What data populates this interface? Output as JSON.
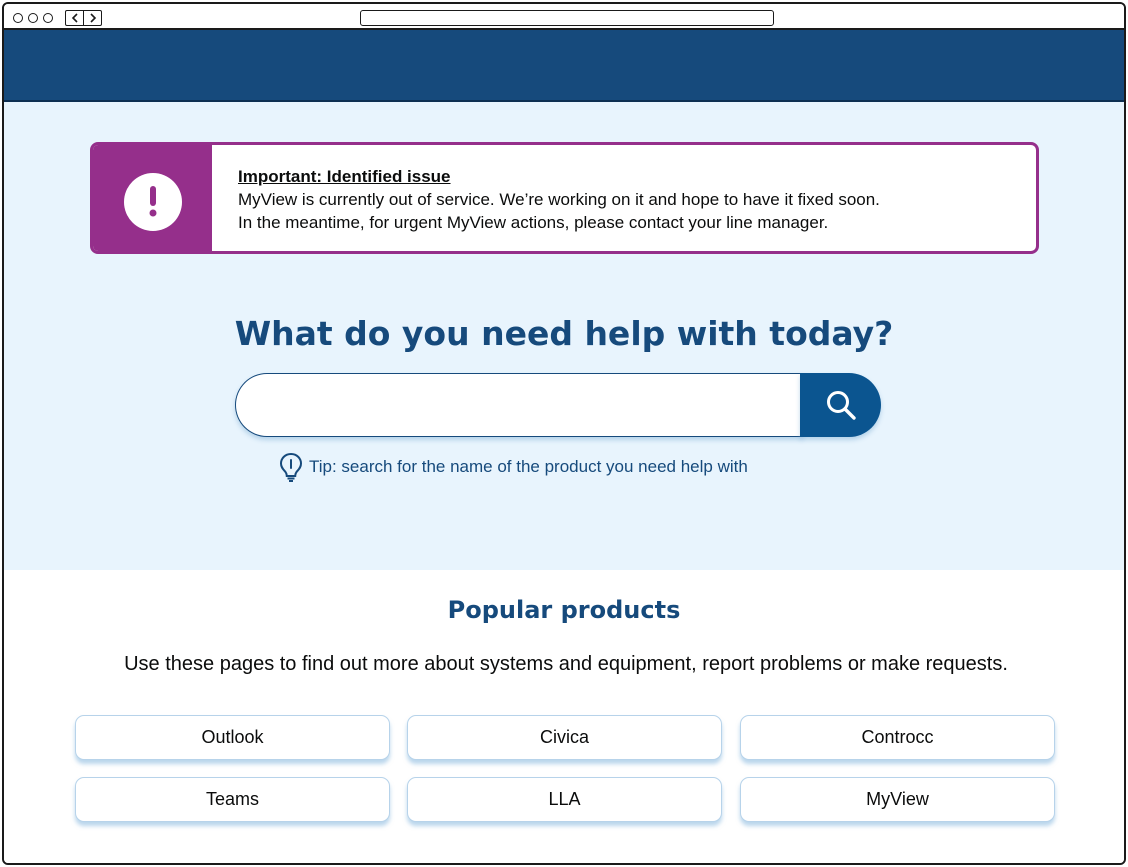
{
  "alert": {
    "title": "Important: Identified issue",
    "line1": "MyView is currently out of service. We’re working on it and hope to have it fixed soon.",
    "line2": "In the meantime, for urgent MyView actions, please contact your line manager.",
    "icon": "exclamation-icon",
    "color": "#952f8b"
  },
  "hero": {
    "title": "What do you need help with today?",
    "search_value": "",
    "search_placeholder": "",
    "tip": "Tip: search for the name of the product you need help with"
  },
  "popular": {
    "title": "Popular products",
    "description": "Use these pages to find out more about systems and equipment, report problems or make requests.",
    "items": [
      {
        "label": "Outlook"
      },
      {
        "label": "Civica"
      },
      {
        "label": "Controcc"
      },
      {
        "label": "Teams"
      },
      {
        "label": "LLA"
      },
      {
        "label": "MyView"
      }
    ]
  },
  "colors": {
    "header": "#164a7c",
    "hero_bg": "#e8f4fd",
    "accent": "#0b5590"
  }
}
